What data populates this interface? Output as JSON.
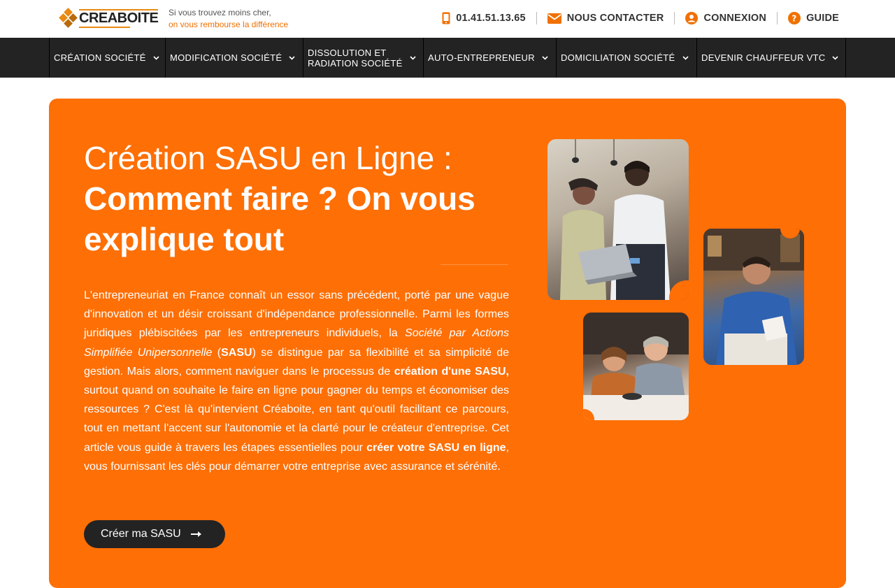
{
  "header": {
    "logo_text": "CREABOITE",
    "tagline_line1": "Si vous trouvez moins cher,",
    "tagline_line2": "on vous rembourse la différence",
    "phone": "01.41.51.13.65",
    "contact_label": "NOUS CONTACTER",
    "login_label": "CONNEXION",
    "guide_label": "GUIDE"
  },
  "nav": {
    "items": [
      {
        "label": "CRÉATION SOCIÉTÉ"
      },
      {
        "label": "MODIFICATION SOCIÉTÉ"
      },
      {
        "label": "DISSOLUTION ET\nRADIATION SOCIÉTÉ"
      },
      {
        "label": "AUTO-ENTREPRENEUR"
      },
      {
        "label": "DOMICILIATION SOCIÉTÉ"
      },
      {
        "label": "DEVENIR CHAUFFEUR VTC"
      }
    ]
  },
  "hero": {
    "title_line1": "Création SASU en Ligne :",
    "title_line2": "Comment faire ? On vous explique tout",
    "body": {
      "p1": "L'entrepreneuriat en France connaît un essor sans précédent, porté par une vague d'innovation et un désir croissant d'indépendance professionnelle. Parmi les formes juridiques plébiscitées par les entrepreneurs individuels, la ",
      "em1": "Société par Actions Simplifiée Unipersonnelle",
      "p2": " (",
      "b1": "SASU",
      "p3": ") se distingue par sa flexibilité et sa simplicité de gestion. Mais alors, comment naviguer dans le processus de ",
      "b2": "création d'une SASU,",
      "p4": " surtout quand on souhaite le faire en ligne pour gagner du temps et économiser des ressources ? C'est là qu'intervient Créaboite, en tant qu'outil facilitant ce parcours, tout en mettant l'accent sur l'autonomie et la clarté pour le créateur d'entreprise. Cet article vous guide à travers les étapes essentielles pour ",
      "b3": "créer votre SASU en ligne",
      "p5": ", vous fournissant les clés pour démarrer votre entreprise avec assurance et sérénité."
    },
    "cta_label": "Créer ma SASU"
  },
  "colors": {
    "brand_orange": "#fe6f06",
    "nav_bg": "#232323",
    "cta_bg": "#232323"
  },
  "icons": {
    "phone": "phone-icon",
    "contact": "envelope-icon",
    "login": "user-circle-icon",
    "guide": "question-circle-icon",
    "nav_chevron": "chevron-down-icon",
    "cta": "arrow-right-icon"
  }
}
